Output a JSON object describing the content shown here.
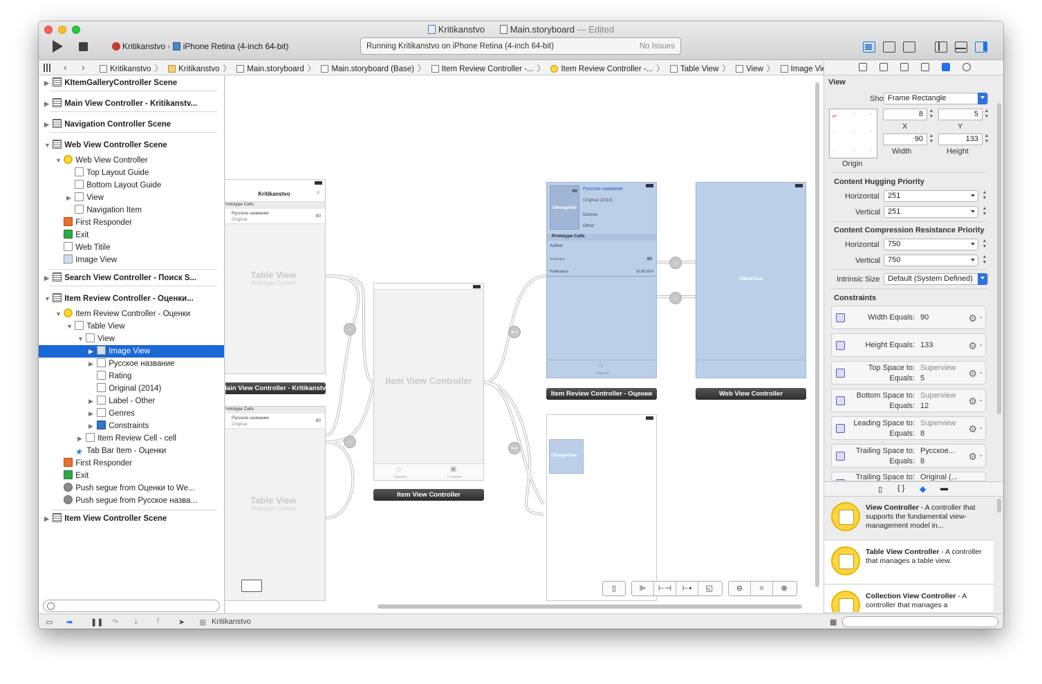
{
  "window": {
    "project": "Kritikanstvo",
    "file": "Main.storyboard",
    "edited": "— Edited"
  },
  "toolbar": {
    "scheme": "Kritikanstvo",
    "device": "iPhone Retina (4-inch 64-bit)",
    "activity": "Running Kritikanstvo on iPhone Retina (4-inch 64-bit)",
    "issues": "No Issues"
  },
  "jumpbar": [
    "Kritikanstvo",
    "Kritikanstvo",
    "Main.storyboard",
    "Main.storyboard (Base)",
    "Item Review Controller -...",
    "Item Review Controller -...",
    "Table View",
    "View",
    "Image View"
  ],
  "outline": [
    {
      "label": "KItemGalleryController Scene",
      "scene": true
    },
    {
      "label": "Main View Controller - Kritikanstv...",
      "scene": true
    },
    {
      "label": "Navigation Controller Scene",
      "scene": true
    },
    {
      "label": "Web View Controller Scene",
      "scene": true
    },
    {
      "label": "Web View Controller"
    },
    {
      "label": "Top Layout Guide"
    },
    {
      "label": "Bottom Layout Guide"
    },
    {
      "label": "View"
    },
    {
      "label": "Navigation Item"
    },
    {
      "label": "First Responder"
    },
    {
      "label": "Exit"
    },
    {
      "label": "Web Titile"
    },
    {
      "label": "Image View"
    },
    {
      "label": "Search View Controller - Поиск S...",
      "scene": true
    },
    {
      "label": "Item Review Controller - Оценки...",
      "scene": true
    },
    {
      "label": "Item Review Controller - Оценки"
    },
    {
      "label": "Table View"
    },
    {
      "label": "View"
    },
    {
      "label": "Image View",
      "selected": true
    },
    {
      "label": "Русское название"
    },
    {
      "label": "Rating"
    },
    {
      "label": "Original (2014)"
    },
    {
      "label": "Label - Other"
    },
    {
      "label": "Genres"
    },
    {
      "label": "Constraints"
    },
    {
      "label": "Item Review Cell - cell"
    },
    {
      "label": "Tab Bar Item - Оценки"
    },
    {
      "label": "First Responder"
    },
    {
      "label": "Exit"
    },
    {
      "label": "Push segue from Оценки to We..."
    },
    {
      "label": "Push segue from Русское назва..."
    },
    {
      "label": "Item View Controller Scene",
      "scene": true
    }
  ],
  "canvas": {
    "main_nav_title": "Kritikanstvo",
    "prototype_cells": "Prototype Cells",
    "cell_title": "Русское название",
    "cell_sub": "Original",
    "cell_num": "80",
    "table_view": "Table View",
    "prototype_content": "Prototype Content",
    "item_view_controller": "Item View Controller",
    "tab1": "Оценки",
    "tab2": "Галерея",
    "label_main": "Main View Controller - Kritikanstvo",
    "label_item": "Item View Controller",
    "label_review": "Item Review Controller - Оценки",
    "label_web": "Web View Controller",
    "review": {
      "num": "80",
      "img": "UIImageVie",
      "title": "Русское название",
      "orig": "Original (2014)",
      "genres": "Genres",
      "other": "Other",
      "proto": "Prototype Cells",
      "author": "Author",
      "summary": "Summary",
      "rating": "80",
      "publication": "Publication",
      "date": "25.08.2014",
      "tab": "Оценки"
    },
    "webview": "UIWebView",
    "imageview": "UIImageView"
  },
  "inspector": {
    "title": "View",
    "show_label": "Show",
    "show_value": "Frame Rectangle",
    "x": "8",
    "y": "5",
    "x_label": "X",
    "y_label": "Y",
    "width": "90",
    "height": "133",
    "width_label": "Width",
    "height_label": "Height",
    "origin": "Origin",
    "hug_title": "Content Hugging Priority",
    "horizontal": "Horizontal",
    "vertical": "Vertical",
    "hug_h": "251",
    "hug_v": "251",
    "comp_title": "Content Compression Resistance Priority",
    "comp_h": "750",
    "comp_v": "750",
    "intrinsic_label": "Intrinsic Size",
    "intrinsic_value": "Default (System Defined)",
    "constraints_title": "Constraints",
    "constraints": [
      {
        "a": "Width Equals:",
        "b": "90",
        "two": false
      },
      {
        "a": "Height Equals:",
        "b": "133",
        "two": false
      },
      {
        "a": "Top Space to:",
        "a2": "Superview",
        "b": "Equals:",
        "b2": "5",
        "two": true
      },
      {
        "a": "Bottom Space to:",
        "a2": "Superview",
        "b": "Equals:",
        "b2": "12",
        "two": true
      },
      {
        "a": "Leading Space to:",
        "a2": "Superview",
        "b": "Equals:",
        "b2": "8",
        "two": true
      },
      {
        "a": "Trailing Space to:",
        "a2": "Русское...",
        "b": "Equals:",
        "b2": "8",
        "two": true
      },
      {
        "a": "Trailing Space to:",
        "a2": "Original (...",
        "b": "",
        "b2": "",
        "two": true
      }
    ]
  },
  "library": [
    {
      "name": "View Controller",
      "desc": " - A controller that supports the fundamental view-management model in..."
    },
    {
      "name": "Table View Controller",
      "desc": " - A controller that manages a table view."
    },
    {
      "name": "Collection View Controller",
      "desc": " - A controller that manages a"
    }
  ],
  "debug": {
    "target": "Kritikanstvo"
  }
}
